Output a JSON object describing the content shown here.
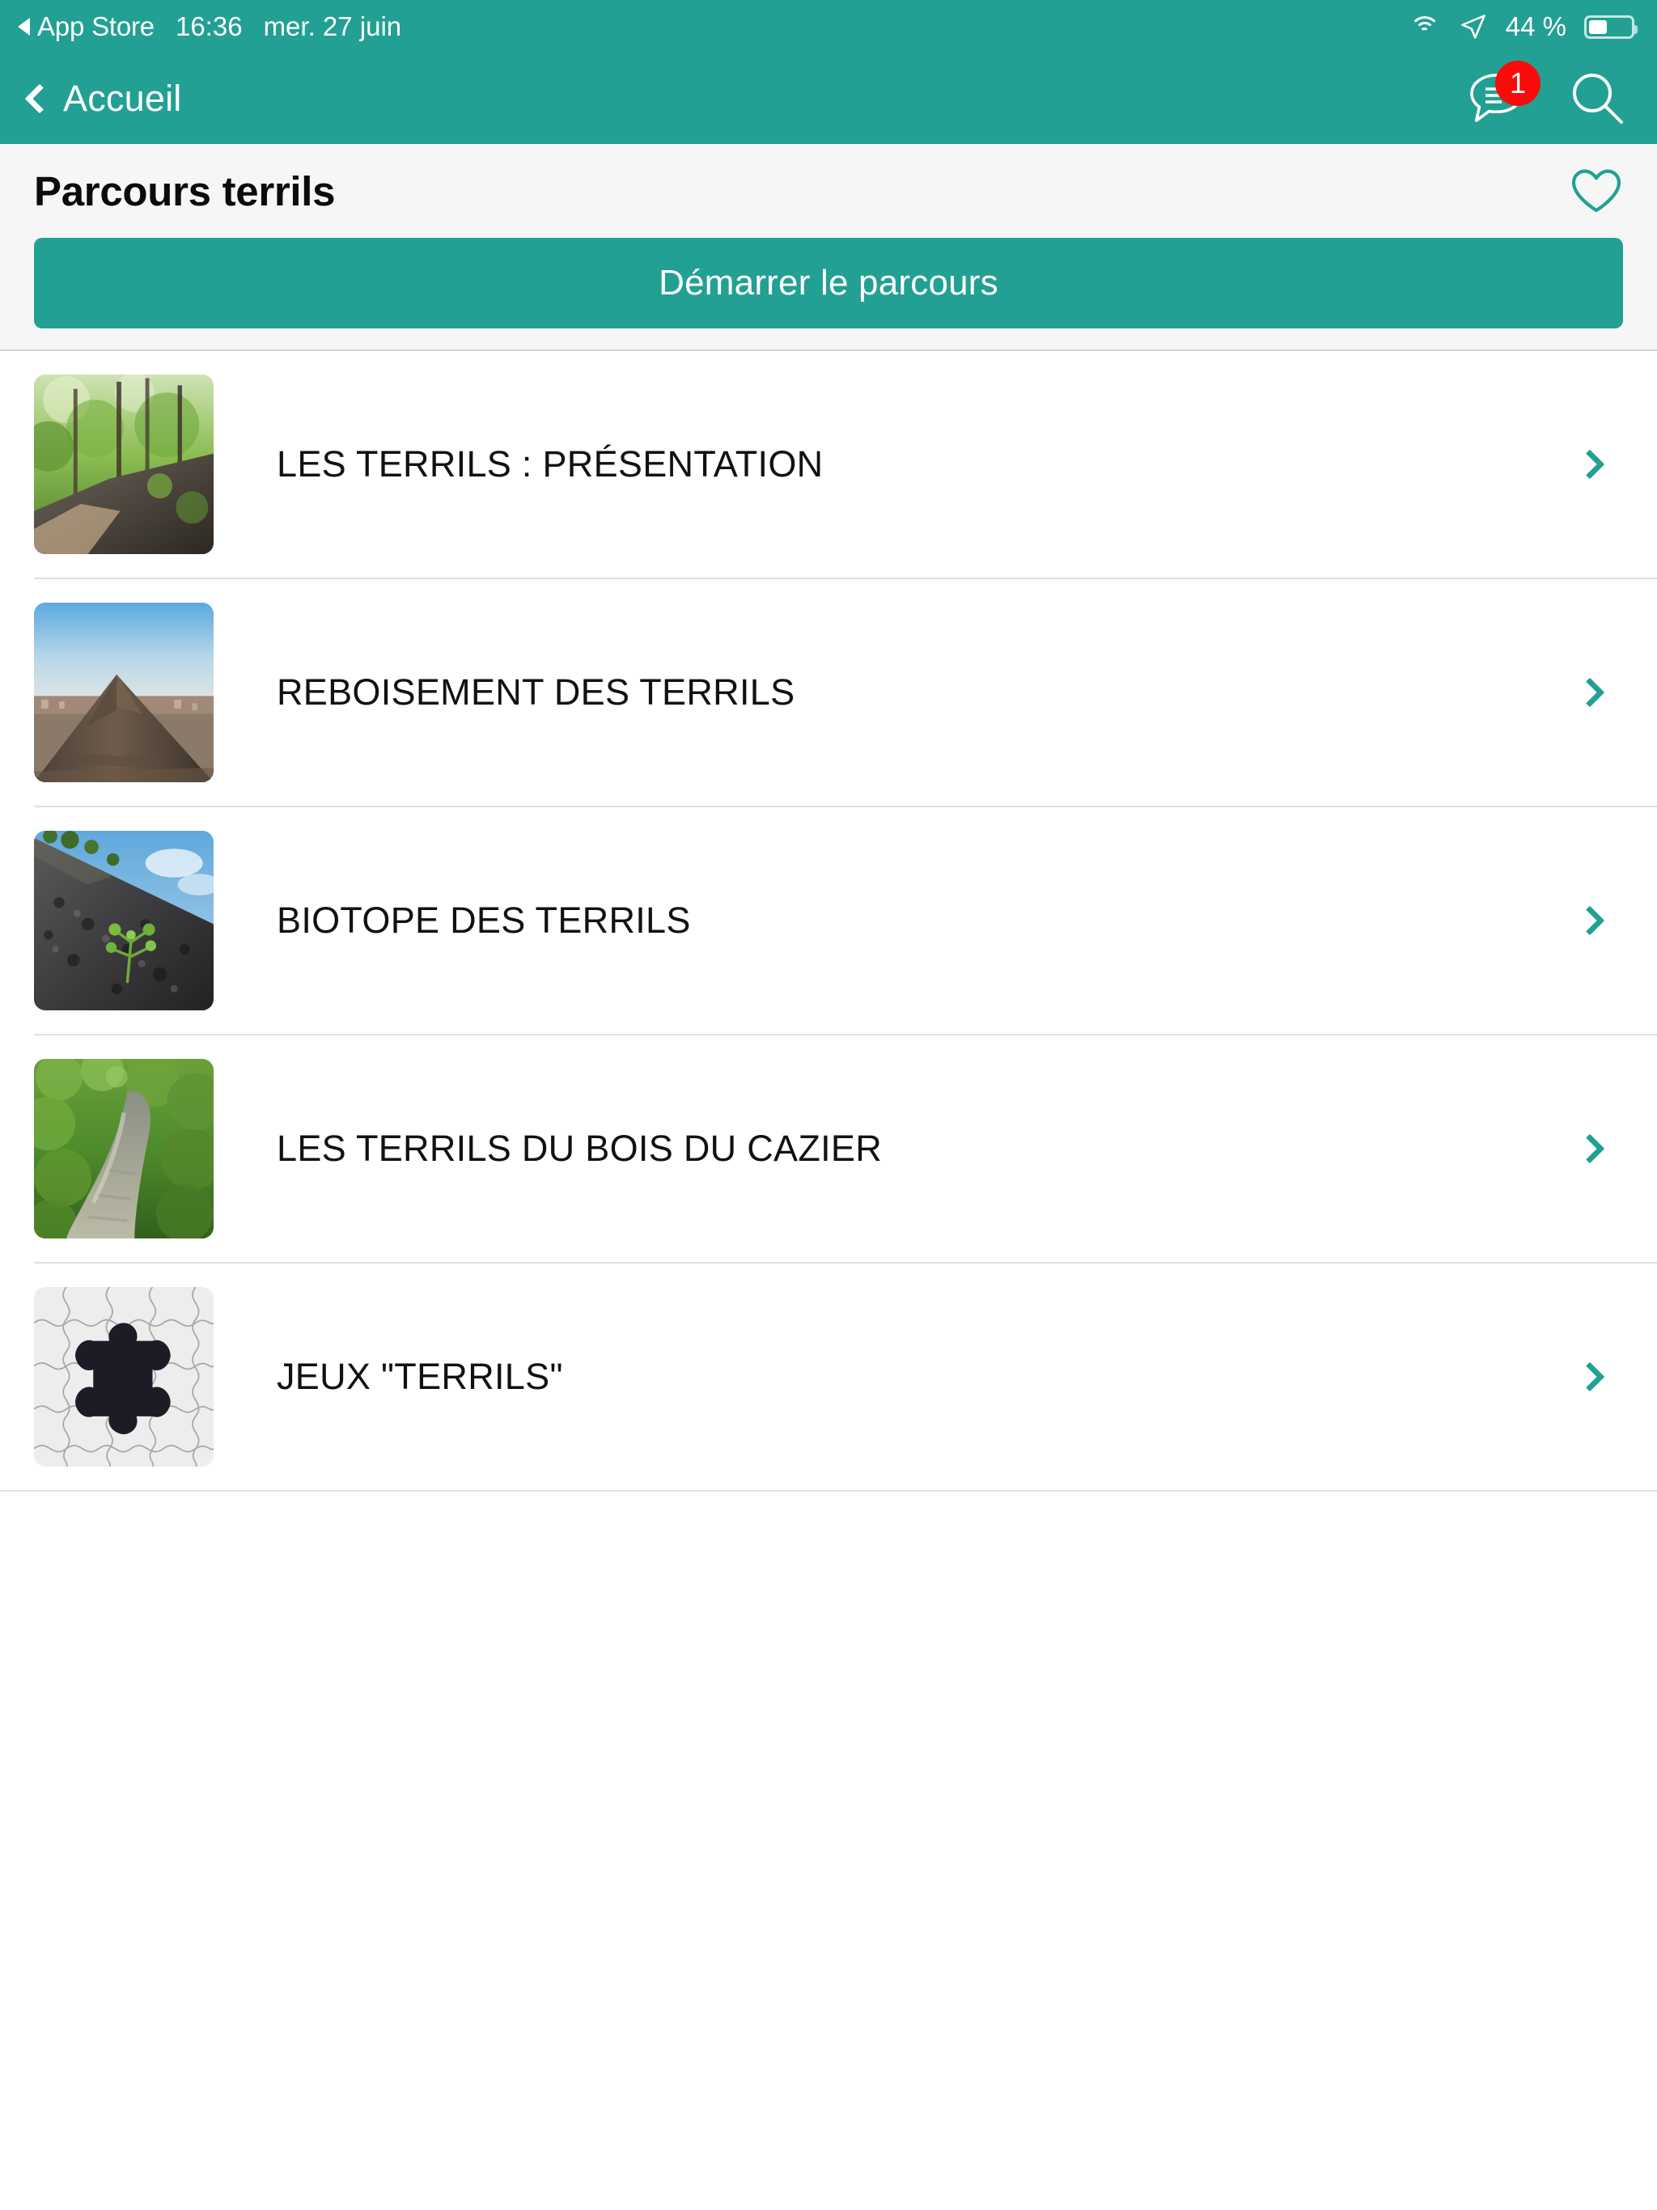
{
  "status_bar": {
    "back_app": "App Store",
    "back_icon": "triangle-left-icon",
    "time": "16:36",
    "date": "mer. 27 juin",
    "wifi_icon": "wifi-icon",
    "location_icon": "location-arrow-icon",
    "battery_percent": "44 %",
    "battery_level": 44,
    "battery_icon": "battery-icon"
  },
  "nav_bar": {
    "back_icon": "chevron-left-icon",
    "back_label": "Accueil",
    "chat_icon": "chat-bubble-icon",
    "chat_badge": "1",
    "search_icon": "search-icon",
    "background_color": "#22a094"
  },
  "header": {
    "title": "Parcours terrils",
    "favorite_icon": "heart-outline-icon",
    "favorite_active": false,
    "start_button_label": "Démarrer le parcours",
    "accent_color": "#22a094"
  },
  "list": {
    "disclosure_icon": "chevron-right-icon",
    "items": [
      {
        "label": "LES TERRILS : PRÉSENTATION",
        "thumbnail": "forest-path-photo"
      },
      {
        "label": "REBOISEMENT DES TERRILS",
        "thumbnail": "slag-heap-cone-photo"
      },
      {
        "label": "BIOTOPE DES TERRILS",
        "thumbnail": "coal-slope-plant-photo"
      },
      {
        "label": "LES TERRILS DU BOIS DU CAZIER",
        "thumbnail": "green-trail-photo"
      },
      {
        "label": "JEUX \"TERRILS\"",
        "thumbnail": "jigsaw-puzzle-photo"
      }
    ]
  }
}
